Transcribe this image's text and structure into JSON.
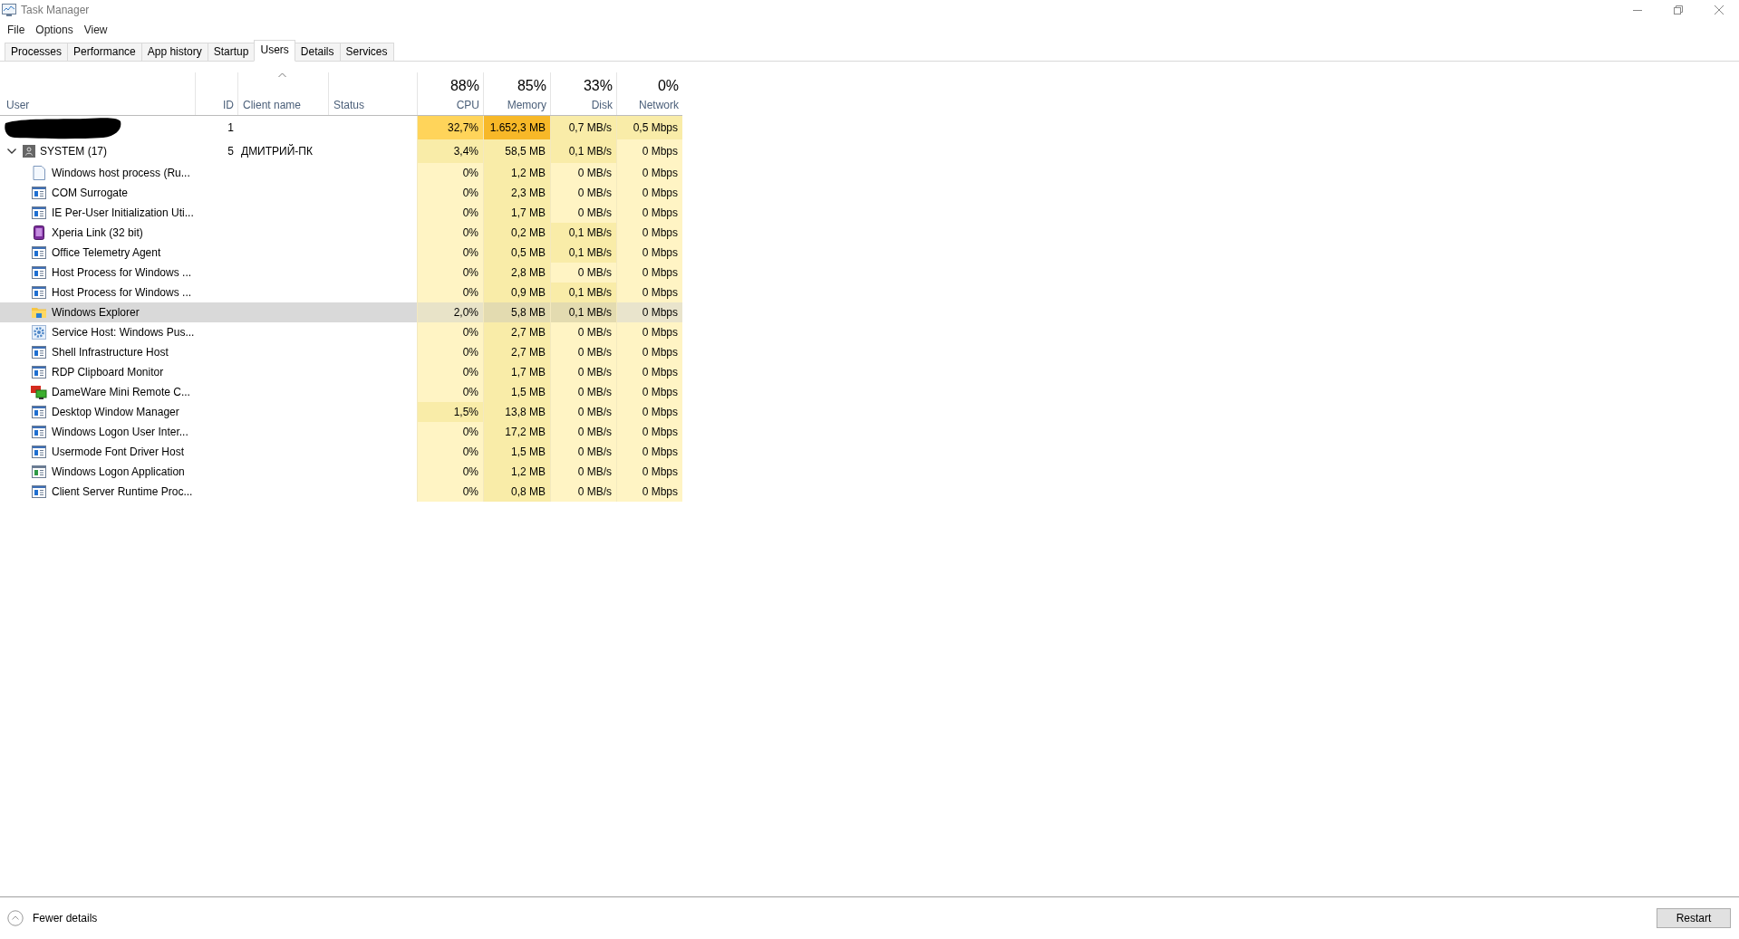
{
  "window": {
    "title": "Task Manager"
  },
  "menu": [
    "File",
    "Options",
    "View"
  ],
  "tabs": [
    {
      "label": "Processes",
      "selected": false
    },
    {
      "label": "Performance",
      "selected": false
    },
    {
      "label": "App history",
      "selected": false
    },
    {
      "label": "Startup",
      "selected": false
    },
    {
      "label": "Users",
      "selected": true
    },
    {
      "label": "Details",
      "selected": false
    },
    {
      "label": "Services",
      "selected": false
    }
  ],
  "table": {
    "columns": [
      {
        "label": "User",
        "sorted": false
      },
      {
        "label": "ID",
        "sorted": false
      },
      {
        "label": "Client name",
        "sorted": true
      },
      {
        "label": "Status",
        "sorted": false
      },
      {
        "label": "CPU",
        "total": "88%",
        "sorted": false
      },
      {
        "label": "Memory",
        "total": "85%",
        "sorted": false
      },
      {
        "label": "Disk",
        "total": "33%",
        "sorted": false
      },
      {
        "label": "Network",
        "total": "0%",
        "sorted": false
      }
    ],
    "rows": [
      {
        "kind": "user",
        "redacted": true,
        "id": "1",
        "selected": false,
        "metrics": [
          {
            "value": "32,7%",
            "color": "#ffd45a"
          },
          {
            "value": "1.652,3 MB",
            "color": "#f7b828"
          },
          {
            "value": "0,7 MB/s",
            "color": "#f9eca8"
          },
          {
            "value": "0,5 Mbps",
            "color": "#f9eca8"
          }
        ]
      },
      {
        "kind": "group",
        "name": "SYSTEM (17)",
        "expanded": true,
        "id": "5",
        "client": "ДМИТРИЙ-ПК",
        "selected": false,
        "metrics": [
          {
            "value": "3,4%",
            "color": "#f9eca8"
          },
          {
            "value": "58,5 MB",
            "color": "#f9eca8"
          },
          {
            "value": "0,1 MB/s",
            "color": "#f9eca8"
          },
          {
            "value": "0 Mbps",
            "color": "#fff4c4"
          }
        ],
        "children": [
          {
            "name": "Windows host process (Ru...",
            "kind": "page",
            "selected": false,
            "metrics": [
              {
                "value": "0%",
                "color": "#fff4c4"
              },
              {
                "value": "1,2 MB",
                "color": "#f9eca8"
              },
              {
                "value": "0 MB/s",
                "color": "#fff4c4"
              },
              {
                "value": "0 Mbps",
                "color": "#fff4c4"
              }
            ]
          },
          {
            "name": "COM Surrogate",
            "kind": "app",
            "selected": false,
            "metrics": [
              {
                "value": "0%",
                "color": "#fff4c4"
              },
              {
                "value": "2,3 MB",
                "color": "#f9eca8"
              },
              {
                "value": "0 MB/s",
                "color": "#fff4c4"
              },
              {
                "value": "0 Mbps",
                "color": "#fff4c4"
              }
            ]
          },
          {
            "name": "IE Per-User Initialization Uti...",
            "kind": "app",
            "selected": false,
            "metrics": [
              {
                "value": "0%",
                "color": "#fff4c4"
              },
              {
                "value": "1,7 MB",
                "color": "#f9eca8"
              },
              {
                "value": "0 MB/s",
                "color": "#fff4c4"
              },
              {
                "value": "0 Mbps",
                "color": "#fff4c4"
              }
            ]
          },
          {
            "name": "Xperia Link (32 bit)",
            "kind": "phone",
            "selected": false,
            "metrics": [
              {
                "value": "0%",
                "color": "#fff4c4"
              },
              {
                "value": "0,2 MB",
                "color": "#f9eca8"
              },
              {
                "value": "0,1 MB/s",
                "color": "#f9eca8"
              },
              {
                "value": "0 Mbps",
                "color": "#fff4c4"
              }
            ]
          },
          {
            "name": "Office Telemetry Agent",
            "kind": "app",
            "selected": false,
            "metrics": [
              {
                "value": "0%",
                "color": "#fff4c4"
              },
              {
                "value": "0,5 MB",
                "color": "#f9eca8"
              },
              {
                "value": "0,1 MB/s",
                "color": "#f9eca8"
              },
              {
                "value": "0 Mbps",
                "color": "#fff4c4"
              }
            ]
          },
          {
            "name": "Host Process for Windows ...",
            "kind": "app",
            "selected": false,
            "metrics": [
              {
                "value": "0%",
                "color": "#fff4c4"
              },
              {
                "value": "2,8 MB",
                "color": "#f9eca8"
              },
              {
                "value": "0 MB/s",
                "color": "#fff4c4"
              },
              {
                "value": "0 Mbps",
                "color": "#fff4c4"
              }
            ]
          },
          {
            "name": "Host Process for Windows ...",
            "kind": "app",
            "selected": false,
            "metrics": [
              {
                "value": "0%",
                "color": "#fff4c4"
              },
              {
                "value": "0,9 MB",
                "color": "#f9eca8"
              },
              {
                "value": "0,1 MB/s",
                "color": "#f9eca8"
              },
              {
                "value": "0 Mbps",
                "color": "#fff4c4"
              }
            ]
          },
          {
            "name": "Windows Explorer",
            "kind": "folder",
            "selected": true,
            "metrics": [
              {
                "value": "2,0%",
                "color": "#e8e3c8"
              },
              {
                "value": "5,8 MB",
                "color": "#e3dbb0"
              },
              {
                "value": "0,1 MB/s",
                "color": "#e3dbb0"
              },
              {
                "value": "0 Mbps",
                "color": "#e9e4cc"
              }
            ]
          },
          {
            "name": "Service Host: Windows Pus...",
            "kind": "gear",
            "selected": false,
            "metrics": [
              {
                "value": "0%",
                "color": "#fff4c4"
              },
              {
                "value": "2,7 MB",
                "color": "#f9eca8"
              },
              {
                "value": "0 MB/s",
                "color": "#fff4c4"
              },
              {
                "value": "0 Mbps",
                "color": "#fff4c4"
              }
            ]
          },
          {
            "name": "Shell Infrastructure Host",
            "kind": "app",
            "selected": false,
            "metrics": [
              {
                "value": "0%",
                "color": "#fff4c4"
              },
              {
                "value": "2,7 MB",
                "color": "#f9eca8"
              },
              {
                "value": "0 MB/s",
                "color": "#fff4c4"
              },
              {
                "value": "0 Mbps",
                "color": "#fff4c4"
              }
            ]
          },
          {
            "name": "RDP Clipboard Monitor",
            "kind": "app",
            "selected": false,
            "metrics": [
              {
                "value": "0%",
                "color": "#fff4c4"
              },
              {
                "value": "1,7 MB",
                "color": "#f9eca8"
              },
              {
                "value": "0 MB/s",
                "color": "#fff4c4"
              },
              {
                "value": "0 Mbps",
                "color": "#fff4c4"
              }
            ]
          },
          {
            "name": "DameWare Mini Remote C...",
            "kind": "monitors",
            "selected": false,
            "metrics": [
              {
                "value": "0%",
                "color": "#fff4c4"
              },
              {
                "value": "1,5 MB",
                "color": "#f9eca8"
              },
              {
                "value": "0 MB/s",
                "color": "#fff4c4"
              },
              {
                "value": "0 Mbps",
                "color": "#fff4c4"
              }
            ]
          },
          {
            "name": "Desktop Window Manager",
            "kind": "app",
            "selected": false,
            "metrics": [
              {
                "value": "1,5%",
                "color": "#f9eca8"
              },
              {
                "value": "13,8 MB",
                "color": "#f9eca8"
              },
              {
                "value": "0 MB/s",
                "color": "#fff4c4"
              },
              {
                "value": "0 Mbps",
                "color": "#fff4c4"
              }
            ]
          },
          {
            "name": "Windows Logon User Inter...",
            "kind": "app",
            "selected": false,
            "metrics": [
              {
                "value": "0%",
                "color": "#fff4c4"
              },
              {
                "value": "17,2 MB",
                "color": "#f9eca8"
              },
              {
                "value": "0 MB/s",
                "color": "#fff4c4"
              },
              {
                "value": "0 Mbps",
                "color": "#fff4c4"
              }
            ]
          },
          {
            "name": "Usermode Font Driver Host",
            "kind": "app",
            "selected": false,
            "metrics": [
              {
                "value": "0%",
                "color": "#fff4c4"
              },
              {
                "value": "1,5 MB",
                "color": "#f9eca8"
              },
              {
                "value": "0 MB/s",
                "color": "#fff4c4"
              },
              {
                "value": "0 Mbps",
                "color": "#fff4c4"
              }
            ]
          },
          {
            "name": "Windows Logon Application",
            "kind": "app-green",
            "selected": false,
            "metrics": [
              {
                "value": "0%",
                "color": "#fff4c4"
              },
              {
                "value": "1,2 MB",
                "color": "#f9eca8"
              },
              {
                "value": "0 MB/s",
                "color": "#fff4c4"
              },
              {
                "value": "0 Mbps",
                "color": "#fff4c4"
              }
            ]
          },
          {
            "name": "Client Server Runtime Proc...",
            "kind": "app",
            "selected": false,
            "metrics": [
              {
                "value": "0%",
                "color": "#fff4c4"
              },
              {
                "value": "0,8 MB",
                "color": "#f9eca8"
              },
              {
                "value": "0 MB/s",
                "color": "#fff4c4"
              },
              {
                "value": "0 Mbps",
                "color": "#fff4c4"
              }
            ]
          }
        ]
      }
    ]
  },
  "footer": {
    "toggle": "Fewer details",
    "button": "Restart"
  }
}
